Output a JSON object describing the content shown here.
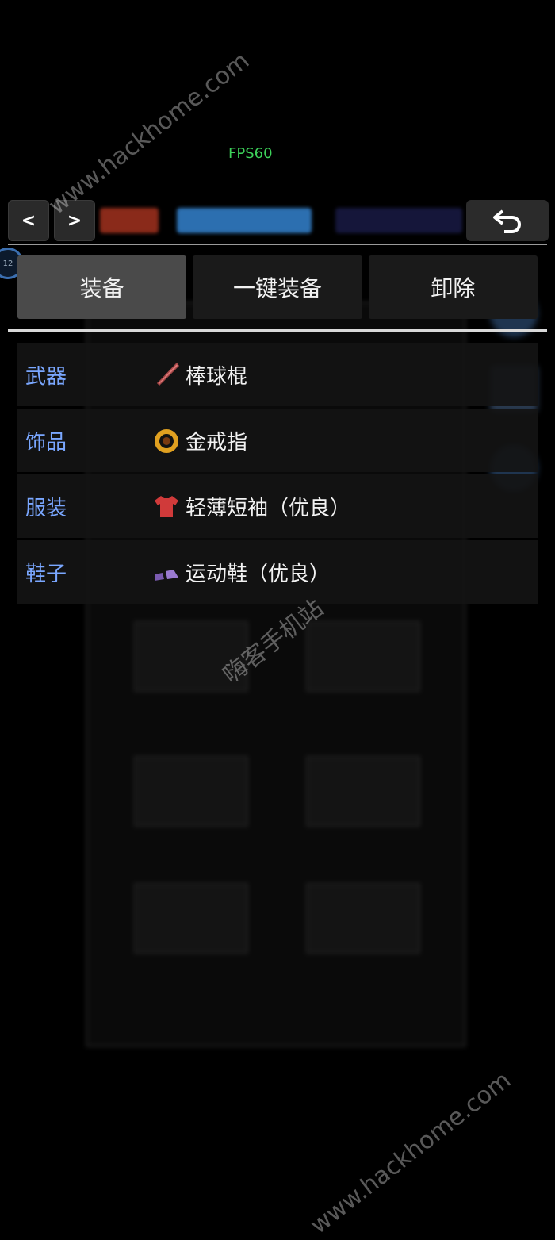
{
  "fps": "FPS60",
  "topbar": {
    "prev_label": "<",
    "next_label": ">",
    "back_label": "↶"
  },
  "avatar_badge": "12",
  "tabs": [
    "装备",
    "一键装备",
    "卸除"
  ],
  "slots": [
    {
      "type": "武器",
      "item": "棒球棍",
      "icon": "bat-icon"
    },
    {
      "type": "饰品",
      "item": "金戒指",
      "icon": "ring-icon"
    },
    {
      "type": "服装",
      "item": "轻薄短袖（优良）",
      "icon": "shirt-icon"
    },
    {
      "type": "鞋子",
      "item": "运动鞋（优良）",
      "icon": "shoes-icon"
    }
  ],
  "watermarks": {
    "top": "www.hackhome.com",
    "middle": "嗨客手机站",
    "bottom": "www.hackhome.com"
  },
  "colors": {
    "fps": "#3dd25a",
    "slot_type": "#7aa7ff",
    "active_tab": "#4a4a4a"
  }
}
